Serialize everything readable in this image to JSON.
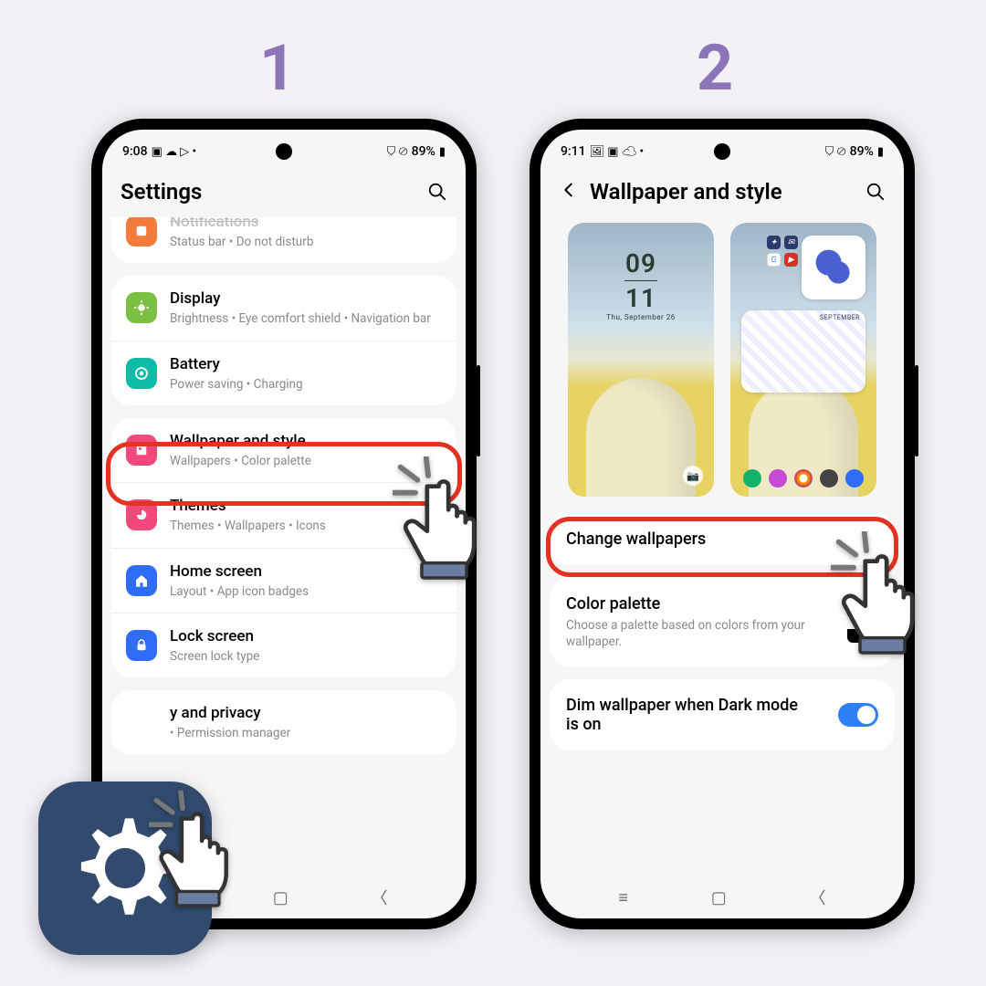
{
  "steps": {
    "one": "1",
    "two": "2"
  },
  "phone1": {
    "status": {
      "time": "9:08",
      "icons_left": "▣ ☁ ▷ •",
      "icons_right": "⛉ ⊘",
      "battery": "89%",
      "batt_glyph": "▮"
    },
    "title": "Settings",
    "rows": {
      "notifications": {
        "title": "Notifications",
        "sub": "Status bar  •  Do not disturb"
      },
      "display": {
        "title": "Display",
        "sub": "Brightness  •  Eye comfort shield  •  Navigation bar"
      },
      "battery": {
        "title": "Battery",
        "sub": "Power saving  •  Charging"
      },
      "wallpaper": {
        "title": "Wallpaper and style",
        "sub": "Wallpapers  •  Color palette"
      },
      "themes": {
        "title": "Themes",
        "sub": "Themes  •  Wallpapers  •  Icons"
      },
      "home": {
        "title": "Home screen",
        "sub": "Layout  •  App icon badges"
      },
      "lock": {
        "title": "Lock screen",
        "sub": "Screen lock type"
      },
      "security": {
        "title": "y and privacy",
        "sub": "•  Permission manager"
      }
    }
  },
  "phone2": {
    "status": {
      "time": "9:11",
      "icons_left": "🖼 ▣ ☁ •",
      "icons_right": "⛉ ⊘",
      "battery": "89%",
      "batt_glyph": "▮"
    },
    "title": "Wallpaper and style",
    "lock_preview": {
      "time_top": "09",
      "time_bottom": "11",
      "date": "Thu, September 26"
    },
    "options": {
      "change": {
        "title": "Change wallpapers"
      },
      "palette": {
        "title": "Color palette",
        "sub": "Choose a palette based on colors from your wallpaper."
      },
      "dim": {
        "title": "Dim wallpaper when Dark mode is on"
      }
    }
  }
}
